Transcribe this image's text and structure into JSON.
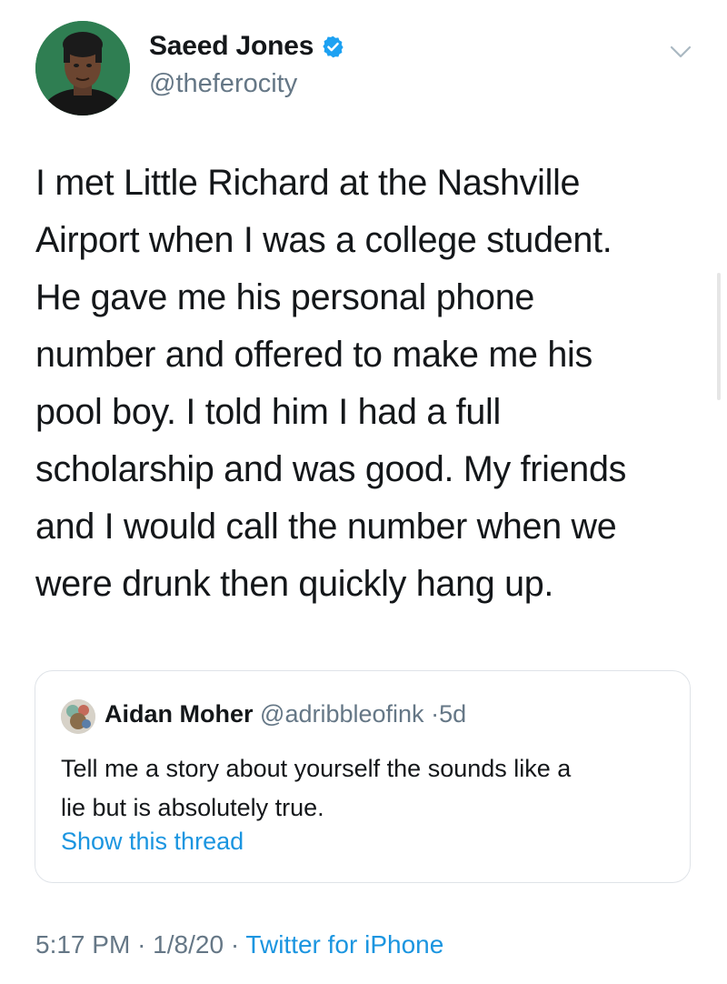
{
  "author": {
    "display_name": "Saeed Jones",
    "handle": "@theferocity",
    "verified": true,
    "avatar_icon": "person-avatar"
  },
  "tweet": {
    "text": "I met Little Richard at the Nashville\nAirport when I was a college student.\nHe gave me his personal phone\nnumber and offered to make me his\npool boy. I told him I had a full\nscholarship and was good. My friends\nand I would call the number when we\nwere drunk then quickly hang up."
  },
  "quoted": {
    "display_name": "Aidan Moher",
    "handle": "@adribbleofink",
    "separator": "·",
    "age": "5d",
    "text": "Tell me a story about yourself the sounds like a\nlie but is absolutely true.",
    "show_thread_label": "Show this thread"
  },
  "meta": {
    "time": "5:17 PM",
    "separator_1": "·",
    "date": "1/8/20",
    "separator_2": "·",
    "source": "Twitter for iPhone"
  },
  "colors": {
    "link": "#1b95e0",
    "secondary_text": "#657786",
    "verified_badge": "#1da1f2",
    "card_border": "#dfe3e8"
  }
}
